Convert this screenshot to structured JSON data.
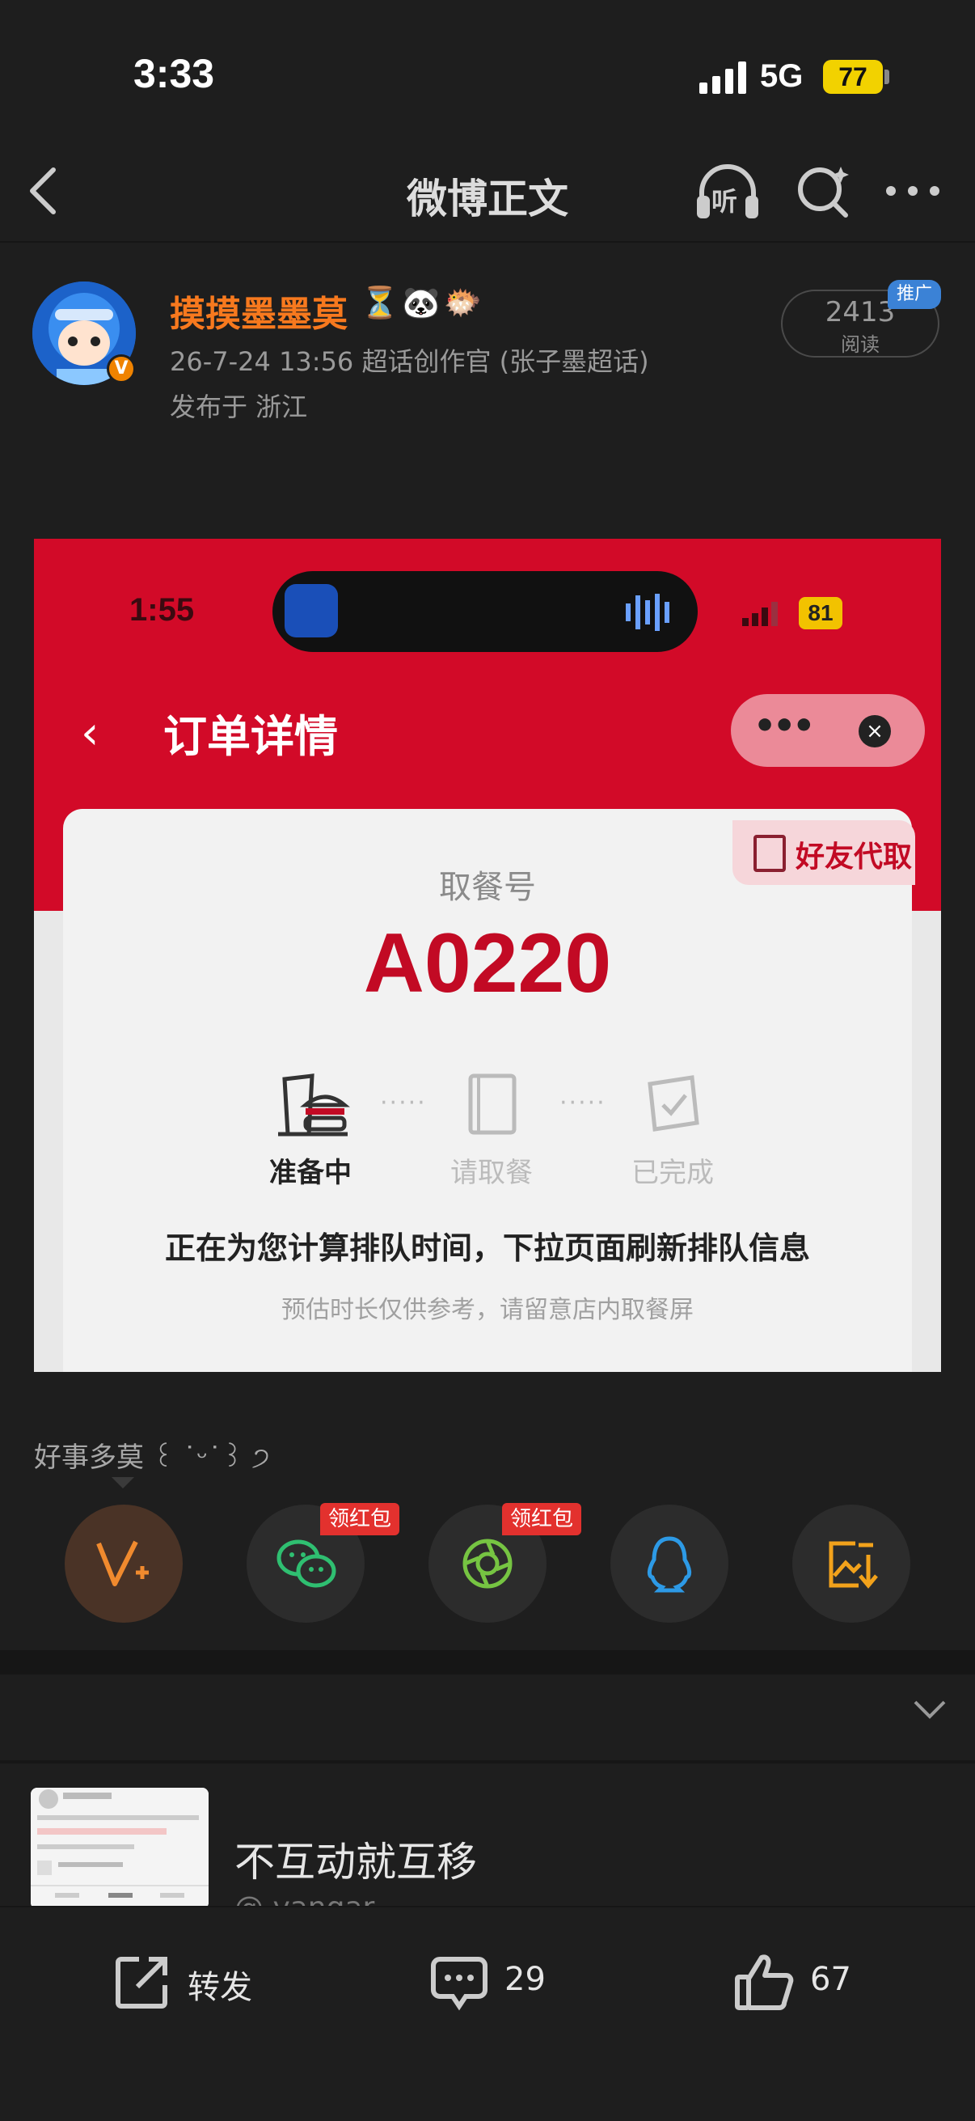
{
  "status_bar": {
    "time": "3:33",
    "network": "5G",
    "battery": "77"
  },
  "nav": {
    "title": "微博正文",
    "listen_icon_label": "听"
  },
  "post": {
    "author": "摸摸墨墨莫",
    "author_emoji": "⏳🐼🐡",
    "meta": "26-7-24 13:56  超话创作官 (张子墨超话)",
    "location": "发布于 浙江",
    "reads_count": "2413",
    "reads_label": "阅读",
    "promo_tag": "推广",
    "caption": "好事多莫 ꒰ ˙ᵕ˙꒱ ੭"
  },
  "screenshot": {
    "time": "1:55",
    "battery": "81",
    "title": "订单详情",
    "friend_pickup": "好友代取",
    "meal_label": "取餐号",
    "meal_number": "A0220",
    "steps": [
      {
        "label": "准备中",
        "state": "active"
      },
      {
        "label": "请取餐",
        "state": "pending"
      },
      {
        "label": "已完成",
        "state": "pending"
      }
    ],
    "notice": "正在为您计算排队时间，下拉页面刷新排队信息",
    "subnotice": "预估时长仅供参考，请留意店内取餐屏"
  },
  "share": {
    "redpacket_label": "领红包",
    "targets": [
      "weibo-repost",
      "wechat",
      "moments",
      "qq",
      "save-image"
    ],
    "colors": {
      "weibo": "#f08a2e",
      "wechat": "#2fbf71",
      "moments": "#76c442",
      "qq": "#2d9ae6",
      "save": "#f2a21b"
    }
  },
  "related": {
    "title": "不互动就互移",
    "subtitle": "@ yangar"
  },
  "toolbar": {
    "repost": "转发",
    "comments": "29",
    "likes": "67"
  }
}
